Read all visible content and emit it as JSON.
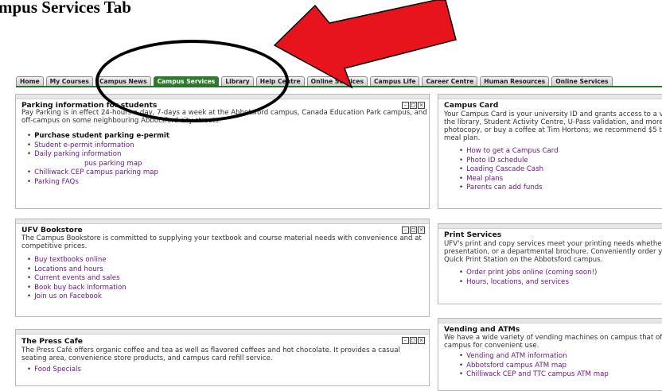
{
  "page": {
    "title": "mpus Services Tab"
  },
  "tabs": [
    {
      "label": "Home"
    },
    {
      "label": "My Courses"
    },
    {
      "label": "Campus News"
    },
    {
      "label": "Campus Services",
      "active": true
    },
    {
      "label": "Library"
    },
    {
      "label": "Help Centre"
    },
    {
      "label": "Online Services"
    },
    {
      "label": "Campus Life"
    },
    {
      "label": "Career Centre"
    },
    {
      "label": "Human Resources"
    },
    {
      "label": "Online Services"
    }
  ],
  "parking": {
    "title": "Parking information for students",
    "text": "Pay Parking is in effect 24-hours a day, 7-days a week at the Abbotsford campus, Canada Education Park campus, and off-campus on some neighbouring Abbotsford city streets.",
    "links": [
      {
        "label": "Purchase student parking e-permit",
        "strong": true
      },
      {
        "label": "Student e-permit information"
      },
      {
        "label": "Daily parking information"
      },
      {
        "label": "pus parking map",
        "bare": true
      },
      {
        "label": "Chilliwack CEP campus parking map"
      },
      {
        "label": "Parking FAQs"
      }
    ]
  },
  "bookstore": {
    "title": "UFV Bookstore",
    "text": "The Campus Bookstore is committed to supplying your textbook and course material needs with convenience and at competitive prices.",
    "links": [
      {
        "label": "Buy textbooks online"
      },
      {
        "label": "Locations and hours"
      },
      {
        "label": "Current events and sales"
      },
      {
        "label": "Book buy back information"
      },
      {
        "label": "Join us on Facebook"
      }
    ]
  },
  "presscafe": {
    "title": "The Press Cafe",
    "text": "The Press Café offers organic coffee and tea as well as flavored coffees and hot chocolate. It provides a casual seating area, convenience store products, and campus card refill service.",
    "links": [
      {
        "label": "Food Specials"
      }
    ]
  },
  "campuscard": {
    "title": "Campus Card",
    "text": "Your Campus Card is your university ID and grants access to a v the library, Student Activity Centre, U-Pass validation, and more. photocopy, or buy a coffee at Tim Hortons; we recommend $5 to meal plan.",
    "links": [
      {
        "label": "How to get a Campus Card"
      },
      {
        "label": "Photo ID schedule"
      },
      {
        "label": "Loading Cascade Cash"
      },
      {
        "label": "Meal plans"
      },
      {
        "label": "Parents can add funds"
      }
    ]
  },
  "print": {
    "title": "Print Services",
    "text": "UFV's print and copy services meet your printing needs whether presentation, or a departmental brochure. Conveniently order yo Quick Print Station on the Abbotsford campus.",
    "links": [
      {
        "label": "Order print jobs online (coming soon!)"
      },
      {
        "label": "Hours, locations, and services"
      }
    ]
  },
  "vending": {
    "title": "Vending and ATMs",
    "text": "We have a wide variety of vending machines on campus that off campus for convenient use.",
    "links": [
      {
        "label": "Vending and ATM information"
      },
      {
        "label": "Abbotsford campus ATM map"
      },
      {
        "label": "Chilliwack CEP and TTC campus ATM map"
      }
    ]
  },
  "controls": {
    "min": "–",
    "max": "□",
    "close": "×"
  },
  "colors": {
    "active_tab": "#2f7a2f",
    "link": "#6a1b8a",
    "annotation_arrow": "#e8141b"
  }
}
